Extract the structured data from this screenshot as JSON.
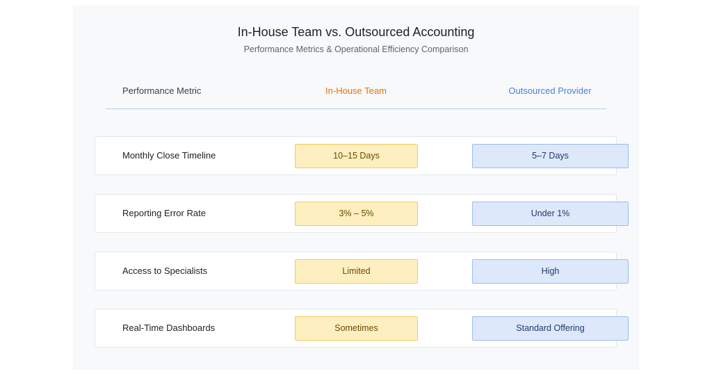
{
  "title": "In-House Team vs. Outsourced Accounting",
  "subtitle": "Performance Metrics & Operational Efficiency Comparison",
  "columns": {
    "metric": "Performance Metric",
    "inhouse": "In-House Team",
    "outsourced": "Outsourced Provider"
  },
  "colors": {
    "inhouse_accent": "#e37400",
    "outsourced_accent": "#4a7fd6",
    "inhouse_fill": "#fdefbf",
    "outsourced_fill": "#dde8fb"
  },
  "rows": [
    {
      "metric": "Monthly Close Timeline",
      "inhouse": "10–15 Days",
      "outsourced": "5–7 Days"
    },
    {
      "metric": "Reporting Error Rate",
      "inhouse": "3% – 5%",
      "outsourced": "Under 1%"
    },
    {
      "metric": "Access to Specialists",
      "inhouse": "Limited",
      "outsourced": "High"
    },
    {
      "metric": "Real-Time Dashboards",
      "inhouse": "Sometimes",
      "outsourced": "Standard Offering"
    }
  ]
}
